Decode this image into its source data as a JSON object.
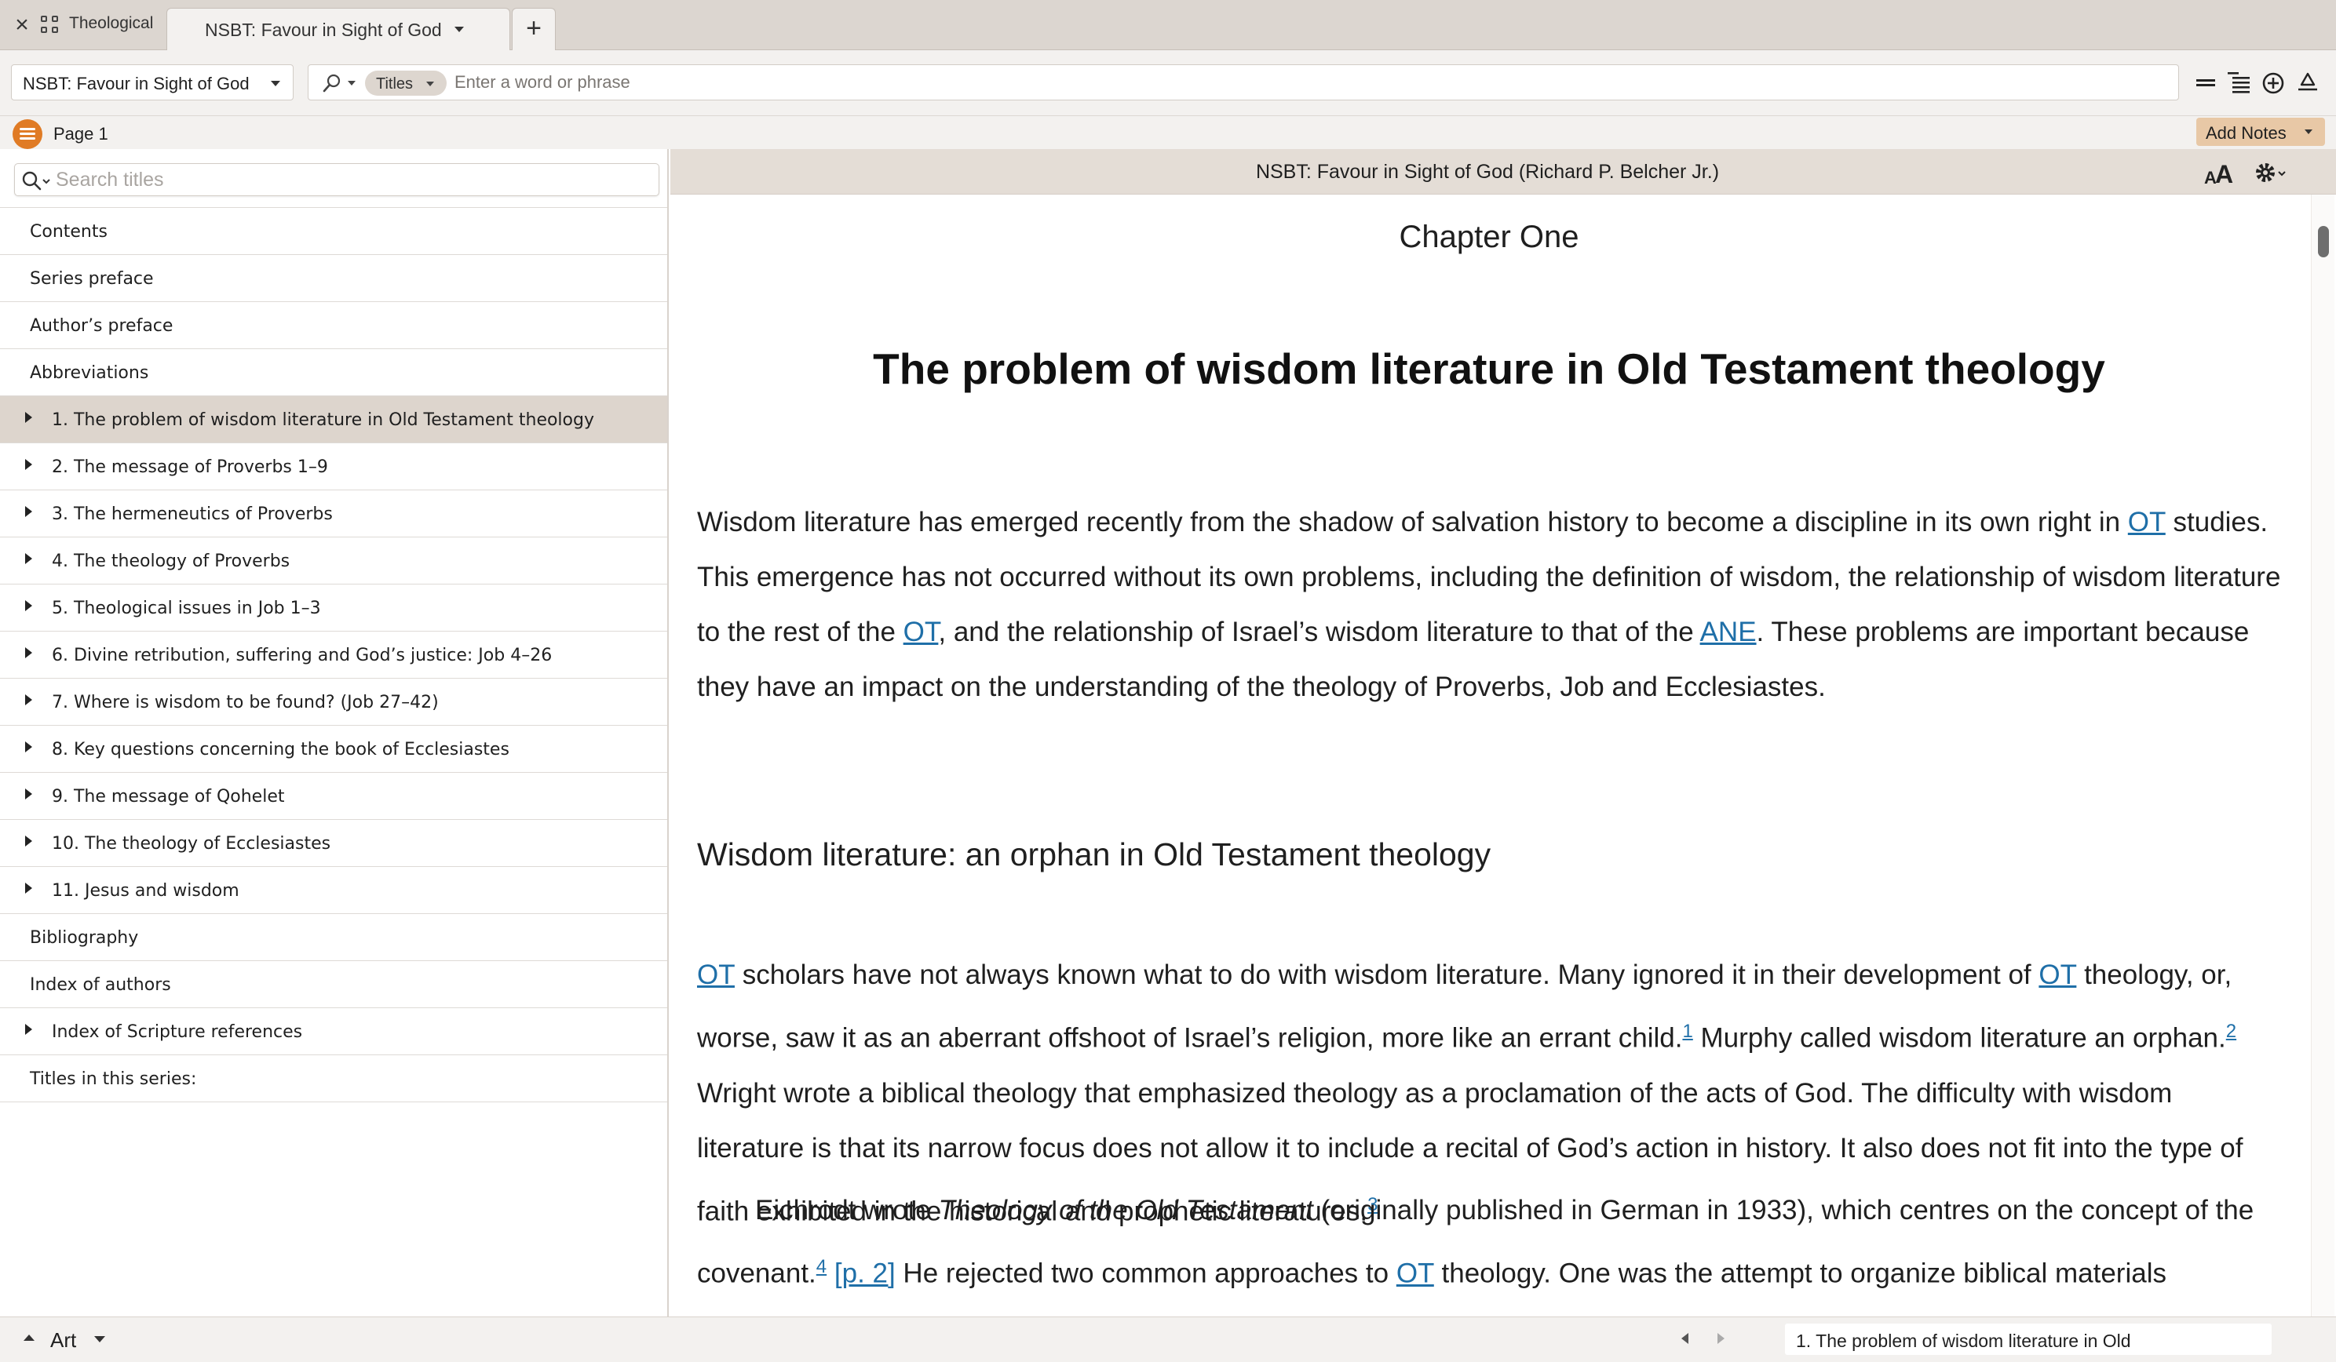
{
  "tabbar": {
    "group_label": "Theological",
    "active_tab": "NSBT: Favour in Sight of God",
    "new_tab_symbol": "+"
  },
  "toolbar": {
    "resource_selector": "NSBT: Favour in Sight of God",
    "search_mode_pill": "Titles",
    "search_placeholder": "Enter a word or phrase",
    "icons": [
      "single-line-icon",
      "text-lines-icon",
      "add-circle-icon",
      "recycle-icon"
    ]
  },
  "pagebar": {
    "page_label": "Page 1",
    "add_notes_label": "Add Notes"
  },
  "sidebar": {
    "search_placeholder": "Search titles",
    "items": [
      {
        "label": "Contents",
        "expandable": false,
        "selected": false
      },
      {
        "label": "Series preface",
        "expandable": false,
        "selected": false
      },
      {
        "label": "Author’s preface",
        "expandable": false,
        "selected": false
      },
      {
        "label": "Abbreviations",
        "expandable": false,
        "selected": false
      },
      {
        "label": "1. The problem of wisdom literature in Old Testament theology",
        "expandable": true,
        "selected": true
      },
      {
        "label": "2. The message of Proverbs 1–9",
        "expandable": true,
        "selected": false
      },
      {
        "label": "3. The hermeneutics of Proverbs",
        "expandable": true,
        "selected": false
      },
      {
        "label": "4. The theology of Proverbs",
        "expandable": true,
        "selected": false
      },
      {
        "label": "5. Theological issues in Job 1–3",
        "expandable": true,
        "selected": false
      },
      {
        "label": "6. Divine retribution, suffering and God’s justice: Job 4–26",
        "expandable": true,
        "selected": false
      },
      {
        "label": "7. Where is wisdom to be found?  (Job 27–42)",
        "expandable": true,
        "selected": false
      },
      {
        "label": "8. Key questions concerning the book of Ecclesiastes",
        "expandable": true,
        "selected": false
      },
      {
        "label": "9. The message of Qohelet",
        "expandable": true,
        "selected": false
      },
      {
        "label": "10. The theology of Ecclesiastes",
        "expandable": true,
        "selected": false
      },
      {
        "label": "11. Jesus and wisdom",
        "expandable": true,
        "selected": false
      },
      {
        "label": "Bibliography",
        "expandable": false,
        "selected": false
      },
      {
        "label": "Index of authors",
        "expandable": false,
        "selected": false
      },
      {
        "label": "Index of Scripture references",
        "expandable": true,
        "selected": false
      },
      {
        "label": "Titles in this series:",
        "expandable": false,
        "selected": false
      }
    ]
  },
  "reader": {
    "header_title": "NSBT: Favour in Sight of God (Richard P. Belcher Jr.)",
    "chapter_label": "Chapter One",
    "chapter_title": "The problem of wisdom literature in Old Testament theology",
    "p1": {
      "t1": "Wisdom literature has emerged recently from the shadow of salvation history to become a discipline in its own right in ",
      "l1": "OT",
      "t2": " studies. This emergence has not occurred without its own problems, including the definition of wisdom, the relationship of wisdom literature to the rest of the ",
      "l2": "OT",
      "t3": ", and the relationship of Israel’s wisdom literature to that of the ",
      "l3": "ANE",
      "t4": ". These problems are important because they have an impact on the understanding of the theology of Proverbs, Job and Ecclesiastes."
    },
    "section_heading": "Wisdom literature: an orphan in Old Testament theology",
    "p2": {
      "l1": "OT",
      "t1": " scholars have not always known what to do with wisdom literature. Many ignored it in their development of ",
      "l2": "OT",
      "t2": " theology, or, worse, saw it as an aberrant offshoot of Israel’s religion, more like an errant child.",
      "fn1": "1",
      "t3": " Murphy called wisdom literature an orphan.",
      "fn2": "2",
      "t4": " Wright wrote a biblical theology that emphasized theology as a proclamation of the acts of God. The difficulty with wisdom literature is that its narrow focus does not allow it to include a recital of God’s action in history. It also does not fit into the type of faith exhibited in the historical and prophetic literatures.",
      "fn3": "3"
    },
    "p3": {
      "t1": "Eichrodt wrote ",
      "em1": "Theology of the Old Testament",
      "t2": " (originally published in German in 1933), which centres on the concept of the covenant.",
      "fn4": "4",
      "page_ref": "[p. 2]",
      "t3": " He rejected two common approaches to ",
      "l1": "OT",
      "t4": " theology. One was the attempt to organize biblical materials"
    }
  },
  "statusbar": {
    "layout_label": "Art",
    "location_label": "1. The problem of wisdom literature in Old"
  },
  "colors": {
    "accent": "#e07b25",
    "link": "#1f6fa8",
    "selection": "#ddd5cd",
    "chrome": "#f3f1ef"
  }
}
